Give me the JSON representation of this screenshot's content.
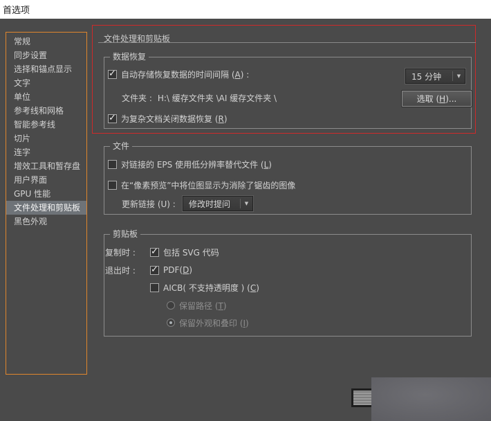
{
  "header": {
    "title": "首选项"
  },
  "sidebar": {
    "items": [
      "常规",
      "同步设置",
      "选择和锚点显示",
      "文字",
      "单位",
      "参考线和网格",
      "智能参考线",
      "切片",
      "连字",
      "增效工具和暂存盘",
      "用户界面",
      "GPU 性能",
      "文件处理和剪贴板",
      "黑色外观"
    ],
    "selected_index": 12
  },
  "panel": {
    "title": "文件处理和剪贴板",
    "data_recovery": {
      "legend": "数据恢复",
      "autosave_pre": "自动存储恢复数据的时间间隔 (",
      "autosave_key": "A",
      "autosave_post": ") :",
      "interval_value": "15 分钟",
      "folder_label": "文件夹 :",
      "folder_path": "H:\\ 缓存文件夹 \\AI 缓存文件夹 \\",
      "choose_pre": "选取 (",
      "choose_key": "H",
      "choose_post": ")...",
      "turnoff_pre": "为复杂文档关闭数据恢复 (",
      "turnoff_key": "R",
      "turnoff_post": ")"
    },
    "files": {
      "legend": "文件",
      "eps_pre": "对链接的 EPS 使用低分辨率替代文件 (",
      "eps_key": "L",
      "eps_post": ")",
      "pixel_preview": "在“像素预览”中将位图显示为消除了锯齿的图像",
      "update_label": "更新链接 (U) :",
      "update_value": "修改时提问"
    },
    "clipboard": {
      "legend": "剪贴板",
      "on_copy_label": "复制时 :",
      "svg_label": "包括 SVG 代码",
      "on_quit_label": "退出时 :",
      "pdf_pre": "PDF(",
      "pdf_key": "D",
      "pdf_post": ")",
      "aicb_pre": "AICB( 不支持透明度 ) (",
      "aicb_key": "C",
      "aicb_post": ")",
      "paths_pre": "保留路径 (",
      "paths_key": "T",
      "paths_post": ")",
      "appearance_pre": "保留外观和叠印 (",
      "appearance_key": "I",
      "appearance_post": ")"
    }
  },
  "states": {
    "autosave_checked": true,
    "turnoff_recovery_checked": true,
    "eps_lowres_checked": false,
    "pixel_preview_checked": false,
    "include_svg_checked": true,
    "pdf_checked": true,
    "aicb_checked": false,
    "preserve_paths_selected": false,
    "preserve_appearance_selected": true
  },
  "colors": {
    "dialog_bg": "#4a4a4a",
    "sidebar_border": "#e0862d",
    "selected_item_bg": "#6e7378",
    "alert_border": "#cf2a2a",
    "text": "#d2d2d2"
  }
}
